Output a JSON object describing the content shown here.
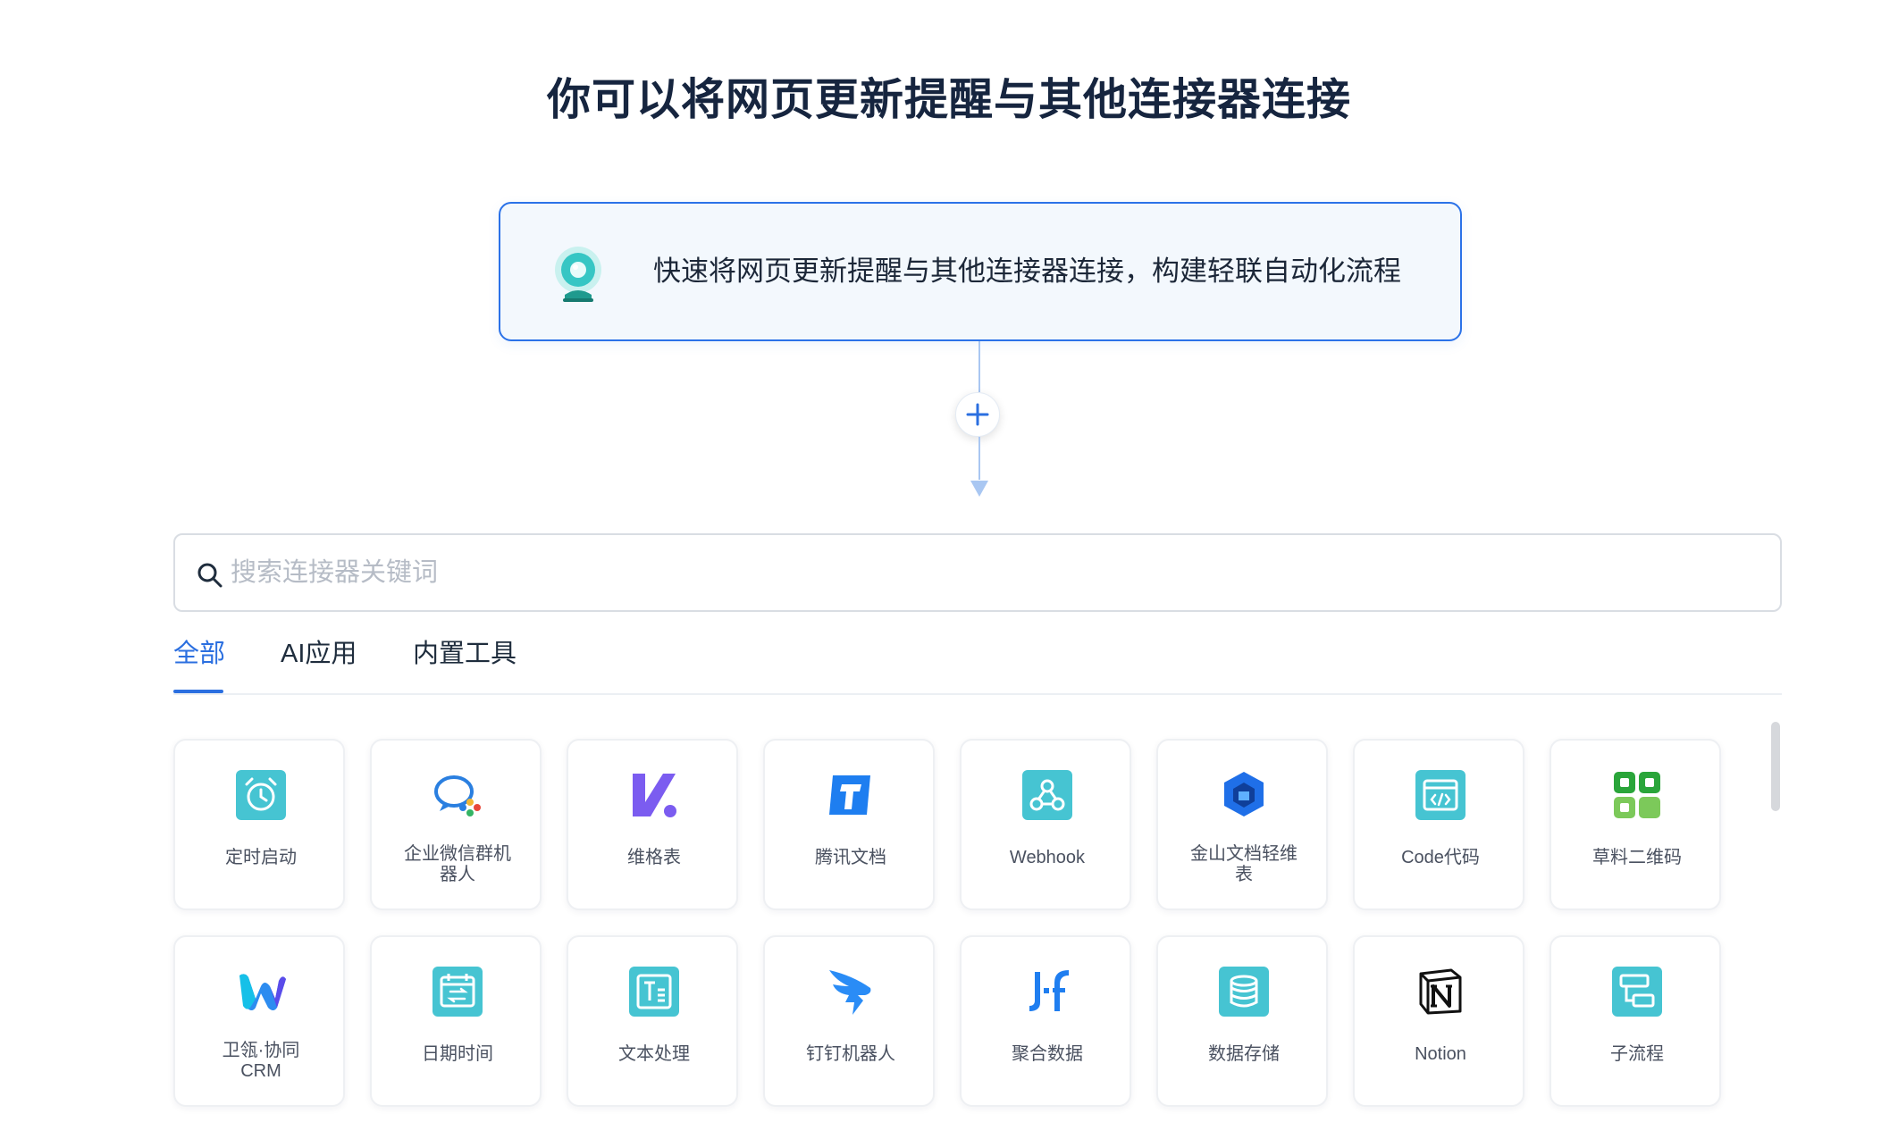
{
  "header": {
    "title": "你可以将网页更新提醒与其他连接器连接"
  },
  "trigger": {
    "text": "快速将网页更新提醒与其他连接器连接，构建轻联自动化流程",
    "icon": "webcam-icon"
  },
  "search": {
    "placeholder": "搜索连接器关键词",
    "value": ""
  },
  "tabs": [
    {
      "label": "全部",
      "active": true
    },
    {
      "label": "AI应用",
      "active": false
    },
    {
      "label": "内置工具",
      "active": false
    }
  ],
  "connectors": [
    {
      "label": "定时启动",
      "icon": "alarm-clock-icon"
    },
    {
      "label": "企业微信群机器人",
      "icon": "wecom-icon"
    },
    {
      "label": "维格表",
      "icon": "vika-icon"
    },
    {
      "label": "腾讯文档",
      "icon": "tencent-docs-icon"
    },
    {
      "label": "Webhook",
      "icon": "webhook-icon"
    },
    {
      "label": "金山文档轻维表",
      "icon": "kdocs-icon"
    },
    {
      "label": "Code代码",
      "icon": "code-icon"
    },
    {
      "label": "草料二维码",
      "icon": "qrcode-icon"
    },
    {
      "label": "卫瓴·协同CRM",
      "icon": "weiling-crm-icon"
    },
    {
      "label": "日期时间",
      "icon": "calendar-icon"
    },
    {
      "label": "文本处理",
      "icon": "text-icon"
    },
    {
      "label": "钉钉机器人",
      "icon": "dingtalk-icon"
    },
    {
      "label": "聚合数据",
      "icon": "juhe-icon"
    },
    {
      "label": "数据存储",
      "icon": "database-icon"
    },
    {
      "label": "Notion",
      "icon": "notion-icon"
    },
    {
      "label": "子流程",
      "icon": "subflow-icon"
    }
  ],
  "colors": {
    "accent": "#2b6fe0",
    "teal": "#35c2cf",
    "title": "#16253f"
  }
}
